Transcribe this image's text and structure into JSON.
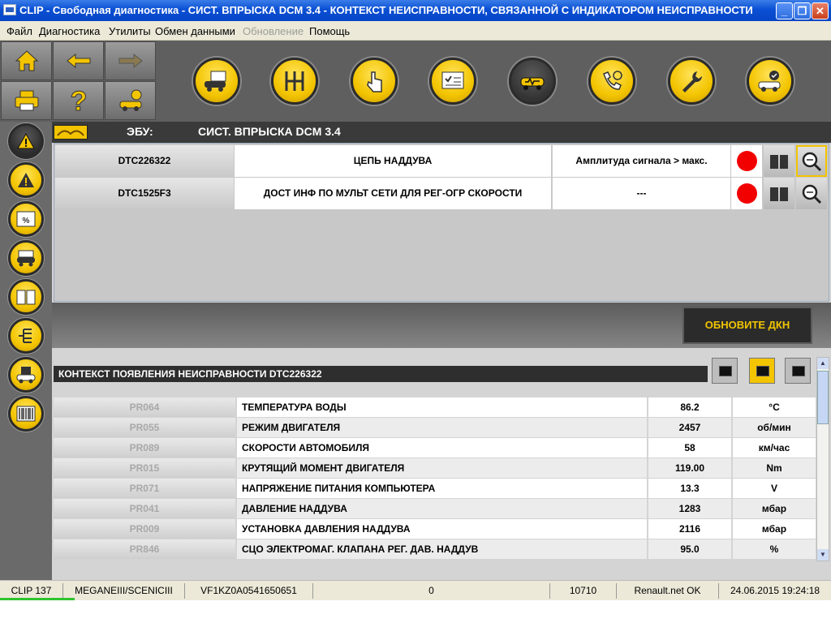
{
  "window": {
    "title": "CLIP - Свободная диагностика - СИСТ. ВПРЫСКА DCM 3.4 - КОНТЕКСТ НЕИСПРАВНОСТИ, СВЯЗАННОЙ С ИНДИКАТОРОМ НЕИСПРАВНОСТИ",
    "controls": [
      "minimize-icon",
      "restore-icon",
      "close-icon"
    ]
  },
  "menu": {
    "items": [
      "Файл",
      "Диагностика",
      "Утилиты",
      "Обмен данными",
      "Обновление",
      "Помощь"
    ],
    "disabled": [
      "Обновление"
    ]
  },
  "nav": {
    "icons": [
      "home-icon",
      "back-arrow-icon",
      "forward-arrow-icon",
      "print-icon",
      "help-icon",
      "vehicle-info-icon"
    ]
  },
  "toolbar": {
    "icons": [
      "vehicle-id-icon",
      "gearbox-icon",
      "touch-icon",
      "checklist-icon",
      "diagnostic-car-icon",
      "phone-support-icon",
      "wrench-icon",
      "car-check-icon"
    ]
  },
  "sidebar": {
    "icons": [
      "warning-icon",
      "warning-icon",
      "parameters-icon",
      "car-status-icon",
      "manual-icon",
      "network-icon",
      "car-data-icon",
      "barcode-icon"
    ]
  },
  "ecu": {
    "label": "ЭБУ:",
    "value": "СИСТ. ВПРЫСКА DCM 3.4"
  },
  "dtc": [
    {
      "code": "DTC226322",
      "description": "ЦЕПЬ НАДДУВА",
      "status": "Амплитуда сигнала > макс.",
      "indicator_color": "#f20000"
    },
    {
      "code": "DTC1525F3",
      "description": "ДОСТ ИНФ ПО МУЛЬТ СЕТИ ДЛЯ РЕГ-ОГР СКОРОСТИ",
      "status": "---",
      "indicator_color": "#f20000"
    }
  ],
  "update_button": "ОБНОВИТЕ ДКН",
  "context": {
    "header": "КОНТЕКСТ ПОЯВЛЕНИЯ НЕИСПРАВНОСТИ DTC226322",
    "params": [
      {
        "id": "PR064",
        "name": "ТЕМПЕРАТУРА ВОДЫ",
        "value": "86.2",
        "unit": "°C"
      },
      {
        "id": "PR055",
        "name": "РЕЖИМ ДВИГАТЕЛЯ",
        "value": "2457",
        "unit": "об/мин"
      },
      {
        "id": "PR089",
        "name": "СКОРОСТИ АВТОМОБИЛЯ",
        "value": "58",
        "unit": "км/час"
      },
      {
        "id": "PR015",
        "name": "КРУТЯЩИЙ МОМЕНТ ДВИГАТЕЛЯ",
        "value": "119.00",
        "unit": "Nm"
      },
      {
        "id": "PR071",
        "name": "НАПРЯЖЕНИЕ ПИТАНИЯ КОМПЬЮТЕРА",
        "value": "13.3",
        "unit": "V"
      },
      {
        "id": "PR041",
        "name": "ДАВЛЕНИЕ НАДДУВА",
        "value": "1283",
        "unit": "мбар"
      },
      {
        "id": "PR009",
        "name": "УСТАНОВКА ДАВЛЕНИЯ НАДДУВА",
        "value": "2116",
        "unit": "мбар"
      },
      {
        "id": "PR846",
        "name": "СЦО ЭЛЕКТРОМАГ. КЛАПАНА РЕГ. ДАВ. НАДДУВ",
        "value": "95.0",
        "unit": "%"
      }
    ]
  },
  "status": {
    "fields": [
      "CLIP 137",
      "MEGANEIII/SCENICIII",
      "VF1KZ0A0541650651",
      "0",
      "10710",
      "Renault.net OK",
      "24.06.2015 19:24:18"
    ]
  },
  "colors": {
    "accent": "#f3c400",
    "title_bar": "#0a4fd4",
    "error": "#f20000"
  }
}
